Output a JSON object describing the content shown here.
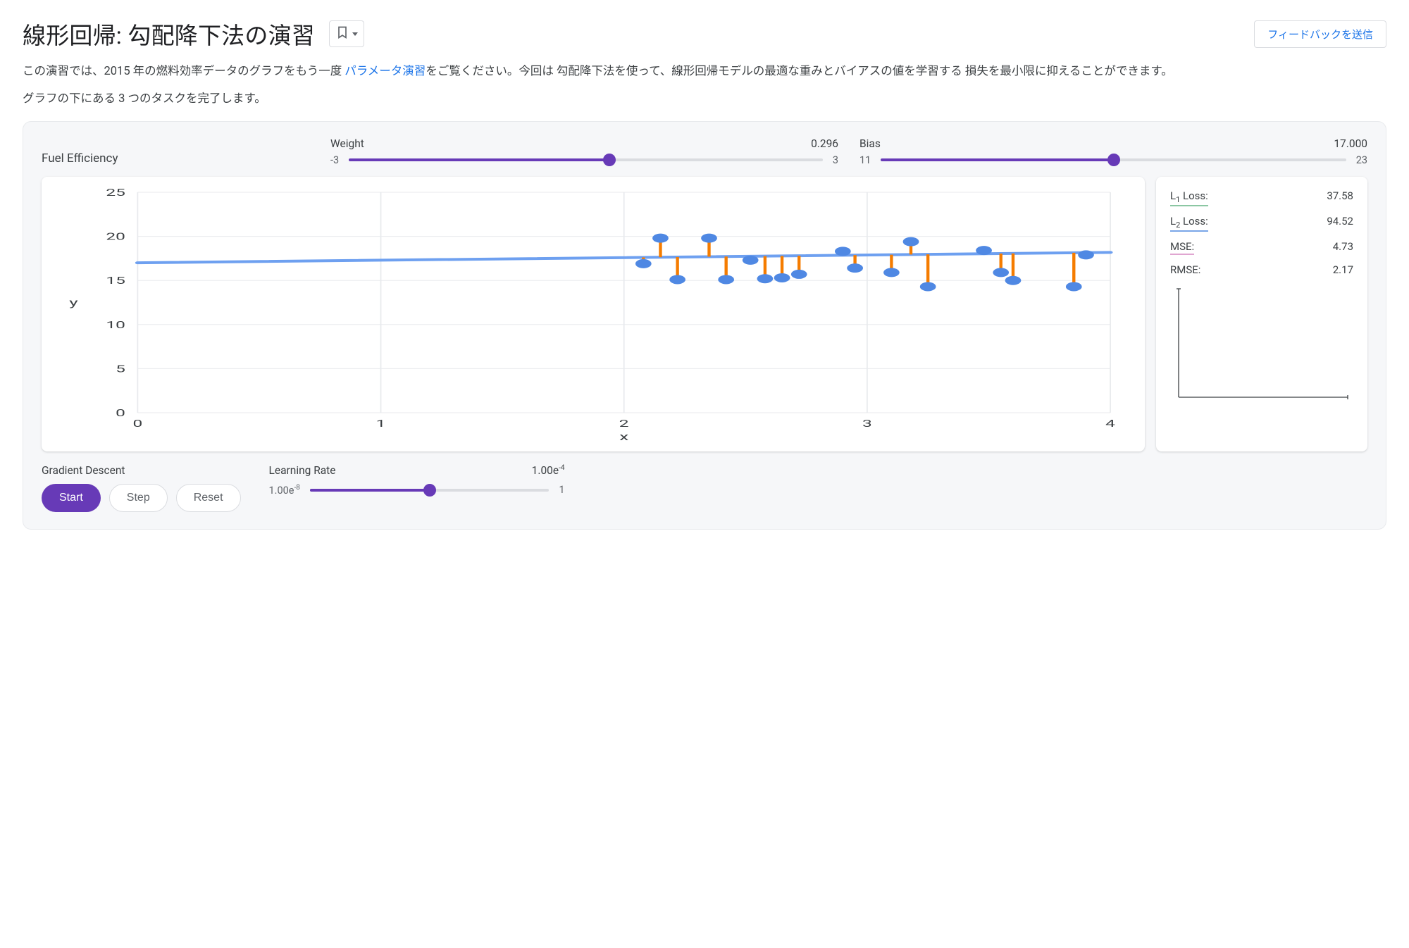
{
  "header": {
    "title": "線形回帰: 勾配降下法の演習",
    "feedback": "フィードバックを送信"
  },
  "intro": {
    "p1a": "この演習では、2015 年の燃料効率データのグラフをもう一度 ",
    "link": "パラメータ演習",
    "p1b": "をご覧ください。今回は 勾配降下法を使って、線形回帰モデルの最適な重みとバイアスの値を学習する 損失を最小限に抑えることができます。",
    "p2": "グラフの下にある 3 つのタスクを完了します。"
  },
  "widget": {
    "chart_title": "Fuel Efficiency",
    "weight": {
      "label": "Weight",
      "value": "0.296",
      "min": "-3",
      "max": "3",
      "pct": 55
    },
    "bias": {
      "label": "Bias",
      "value": "17.000",
      "min": "11",
      "max": "23",
      "pct": 50
    },
    "gd_label": "Gradient Descent",
    "btn_start": "Start",
    "btn_step": "Step",
    "btn_reset": "Reset",
    "lr": {
      "label": "Learning Rate",
      "value": "1.00e",
      "value_exp": "-4",
      "min": "1.00e",
      "min_exp": "-8",
      "max": "1",
      "pct": 50
    }
  },
  "metrics": {
    "l1_label": "L",
    "l1_sub": "1",
    "loss_suffix": " Loss:",
    "l1_value": "37.58",
    "l2_label": "L",
    "l2_sub": "2",
    "l2_value": "94.52",
    "mse_label": "MSE:",
    "mse_value": "4.73",
    "rmse_label": "RMSE:",
    "rmse_value": "2.17"
  },
  "chart_data": {
    "type": "scatter",
    "title": "Fuel Efficiency",
    "xlabel": "x",
    "ylabel": "y",
    "xlim": [
      0,
      4
    ],
    "ylim": [
      0,
      25
    ],
    "xticks": [
      0,
      1,
      2,
      3,
      4
    ],
    "yticks": [
      0,
      5,
      10,
      15,
      20,
      25
    ],
    "regression": {
      "slope": 0.296,
      "intercept": 17.0,
      "x0": 0,
      "x1": 4
    },
    "points": [
      {
        "x": 2.08,
        "y": 16.9
      },
      {
        "x": 2.15,
        "y": 19.8
      },
      {
        "x": 2.22,
        "y": 15.1
      },
      {
        "x": 2.35,
        "y": 19.8
      },
      {
        "x": 2.42,
        "y": 15.1
      },
      {
        "x": 2.52,
        "y": 17.3
      },
      {
        "x": 2.58,
        "y": 15.2
      },
      {
        "x": 2.65,
        "y": 15.3
      },
      {
        "x": 2.72,
        "y": 15.7
      },
      {
        "x": 2.9,
        "y": 18.3
      },
      {
        "x": 2.95,
        "y": 16.4
      },
      {
        "x": 3.1,
        "y": 15.9
      },
      {
        "x": 3.18,
        "y": 19.4
      },
      {
        "x": 3.25,
        "y": 14.3
      },
      {
        "x": 3.48,
        "y": 18.4
      },
      {
        "x": 3.55,
        "y": 15.9
      },
      {
        "x": 3.6,
        "y": 15.0
      },
      {
        "x": 3.85,
        "y": 14.3
      },
      {
        "x": 3.9,
        "y": 17.9
      }
    ]
  }
}
